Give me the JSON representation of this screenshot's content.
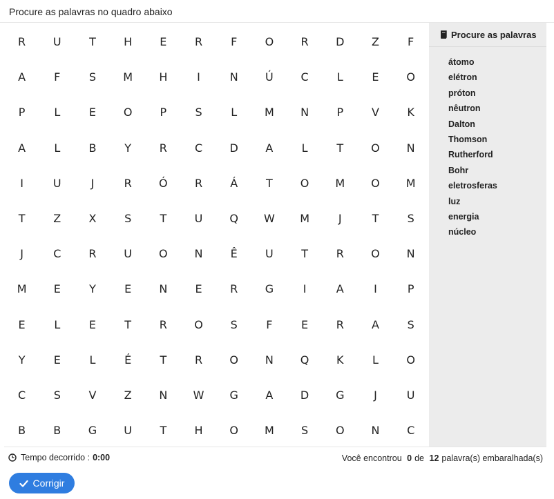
{
  "header": {
    "instruction": "Procure as palavras no quadro abaixo"
  },
  "grid": [
    [
      "R",
      "U",
      "T",
      "H",
      "E",
      "R",
      "F",
      "O",
      "R",
      "D",
      "Z",
      "F"
    ],
    [
      "A",
      "F",
      "S",
      "M",
      "H",
      "I",
      "N",
      "Ú",
      "C",
      "L",
      "E",
      "O"
    ],
    [
      "P",
      "L",
      "E",
      "O",
      "P",
      "S",
      "L",
      "M",
      "N",
      "P",
      "V",
      "K"
    ],
    [
      "A",
      "L",
      "B",
      "Y",
      "R",
      "C",
      "D",
      "A",
      "L",
      "T",
      "O",
      "N"
    ],
    [
      "I",
      "U",
      "J",
      "R",
      "Ó",
      "R",
      "Á",
      "T",
      "O",
      "M",
      "O",
      "M"
    ],
    [
      "T",
      "Z",
      "X",
      "S",
      "T",
      "U",
      "Q",
      "W",
      "M",
      "J",
      "T",
      "S"
    ],
    [
      "J",
      "C",
      "R",
      "U",
      "O",
      "N",
      "Ê",
      "U",
      "T",
      "R",
      "O",
      "N"
    ],
    [
      "M",
      "E",
      "Y",
      "E",
      "N",
      "E",
      "R",
      "G",
      "I",
      "A",
      "I",
      "P"
    ],
    [
      "E",
      "L",
      "E",
      "T",
      "R",
      "O",
      "S",
      "F",
      "E",
      "R",
      "A",
      "S"
    ],
    [
      "Y",
      "E",
      "L",
      "É",
      "T",
      "R",
      "O",
      "N",
      "Q",
      "K",
      "L",
      "O"
    ],
    [
      "C",
      "S",
      "V",
      "Z",
      "N",
      "W",
      "G",
      "A",
      "D",
      "G",
      "J",
      "U"
    ],
    [
      "B",
      "B",
      "G",
      "U",
      "T",
      "H",
      "O",
      "M",
      "S",
      "O",
      "N",
      "C"
    ]
  ],
  "sidebar": {
    "title": "Procure as palavras",
    "icon": "book-icon",
    "words": [
      "átomo",
      "elétron",
      "próton",
      "nêutron",
      "Dalton",
      "Thomson",
      "Rutherford",
      "Bohr",
      "eletrosferas",
      "luz",
      "energia",
      "núcleo"
    ]
  },
  "footer": {
    "timer_icon": "clock-icon",
    "timer_label": "Tempo decorrido :",
    "timer_value": "0:00",
    "found_prefix": "Você encontrou",
    "found_count": "0",
    "found_mid": "de",
    "found_total": "12",
    "found_suffix": "palavra(s) embaralhada(s)"
  },
  "button": {
    "label": "Corrigir",
    "icon": "check-icon",
    "color": "#2f7de0"
  }
}
